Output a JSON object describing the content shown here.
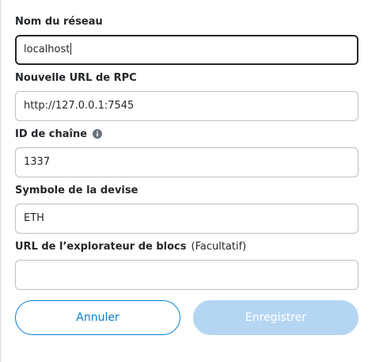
{
  "form": {
    "network_name": {
      "label": "Nom du réseau",
      "value": "localhost"
    },
    "rpc_url": {
      "label": "Nouvelle URL de RPC",
      "value": "http://127.0.0.1:7545"
    },
    "chain_id": {
      "label": "ID de chaîne",
      "value": "1337",
      "info_icon": "info-icon"
    },
    "currency_symbol": {
      "label": "Symbole de la devise",
      "value": "ETH"
    },
    "explorer_url": {
      "label": "URL de l’explorateur de blocs",
      "optional_label": "(Facultatif)",
      "value": ""
    }
  },
  "actions": {
    "cancel_label": "Annuler",
    "save_label": "Enregistrer"
  },
  "colors": {
    "primary": "#037dd6",
    "primary_disabled": "#b5d6f2",
    "text": "#24272a",
    "border": "#bbc0c5"
  }
}
